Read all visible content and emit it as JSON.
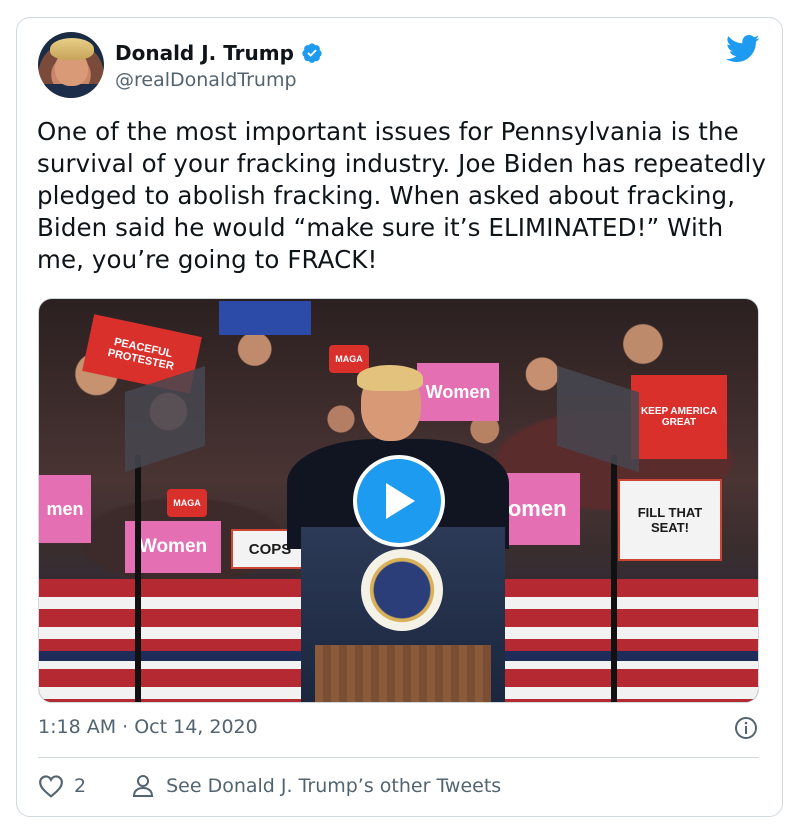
{
  "tweet": {
    "author_name": "Donald J. Trump",
    "author_handle": "@realDonaldTrump",
    "body": "One of the most important issues for Pennsylvania is the survival of your fracking industry. Joe Biden has repeatedly pledged to abolish fracking. When asked about fracking, Biden said he would “make sure it’s ELIMINATED!” With me, you’re going to FRACK!",
    "timestamp": "1:18 AM · Oct 14, 2020",
    "likes": "2",
    "other_tweets_label": "See Donald J. Trump’s other Tweets"
  },
  "media": {
    "signs": {
      "peaceful": "PEACEFUL PROTESTER",
      "women_center": "Women",
      "women_right": "Women",
      "women_left": "Women",
      "fill_seat": "FILL THAT SEAT!",
      "cops": "COPS",
      "keep_america": "KEEP AMERICA GREAT",
      "maga_1": "MAGA",
      "maga_2": "MAGA",
      "women_far_left": "men"
    }
  },
  "colors": {
    "accent": "#1d9bf0",
    "text_secondary": "#536471",
    "border": "#cfd9de"
  },
  "icons": {
    "verified": "verified-badge-icon",
    "brand": "twitter-bird-icon",
    "play": "play-icon",
    "info": "info-icon",
    "like": "heart-icon",
    "profile": "person-icon"
  }
}
